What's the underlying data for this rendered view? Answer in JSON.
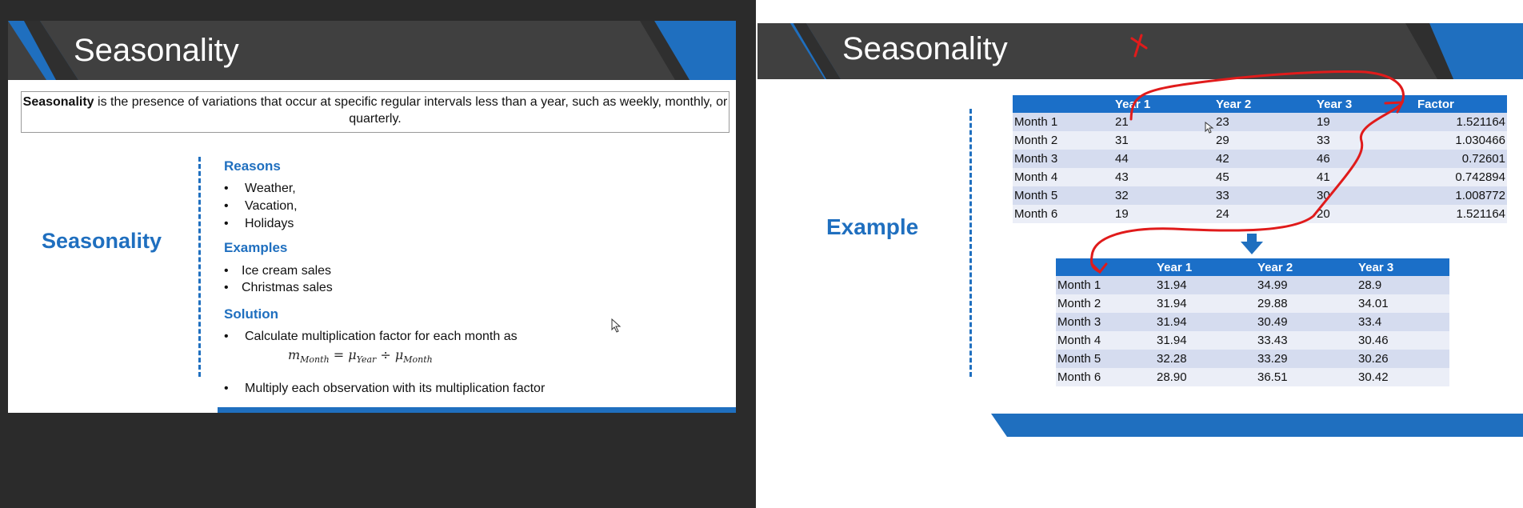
{
  "left_slide": {
    "title": "Seasonality",
    "definition_bold": "Seasonality",
    "definition_rest": " is the presence of variations that occur at specific regular intervals less than a year, such as weekly, monthly, or quarterly.",
    "side_label": "Seasonality",
    "sections": {
      "reasons": {
        "heading": "Reasons",
        "items": [
          "Weather,",
          "Vacation,",
          "Holidays"
        ]
      },
      "examples": {
        "heading": "Examples",
        "items": [
          "Ice cream sales",
          "Christmas sales"
        ]
      },
      "solution": {
        "heading": "Solution",
        "item1": "Calculate multiplication factor for each month as",
        "item2": "Multiply each observation with its multiplication factor"
      }
    },
    "formula": {
      "m": "m",
      "m_sub": "Month",
      "eq": " = ",
      "mu1": "μ",
      "mu1_sub": "Year",
      "div": " ÷ ",
      "mu2": "μ",
      "mu2_sub": "Month"
    },
    "bullet_char": "•"
  },
  "right_slide": {
    "title": "Seasonality",
    "side_label": "Example",
    "table1": {
      "headers": [
        "",
        "Year 1",
        "Year 2",
        "Year 3",
        "Factor"
      ],
      "rows": [
        [
          "Month 1",
          "21",
          "23",
          "19",
          "1.521164"
        ],
        [
          "Month 2",
          "31",
          "29",
          "33",
          "1.030466"
        ],
        [
          "Month 3",
          "44",
          "42",
          "46",
          "0.72601"
        ],
        [
          "Month 4",
          "43",
          "45",
          "41",
          "0.742894"
        ],
        [
          "Month 5",
          "32",
          "33",
          "30",
          "1.008772"
        ],
        [
          "Month 6",
          "19",
          "24",
          "20",
          "1.521164"
        ]
      ]
    },
    "table2": {
      "headers": [
        "",
        "Year 1",
        "Year 2",
        "Year 3"
      ],
      "rows": [
        [
          "Month 1",
          "31.94",
          "34.99",
          "28.9"
        ],
        [
          "Month 2",
          "31.94",
          "29.88",
          "34.01"
        ],
        [
          "Month 3",
          "31.94",
          "30.49",
          "33.4"
        ],
        [
          "Month 4",
          "31.94",
          "33.43",
          "30.46"
        ],
        [
          "Month 5",
          "32.28",
          "33.29",
          "30.26"
        ],
        [
          "Month 6",
          "28.90",
          "36.51",
          "30.42"
        ]
      ]
    }
  },
  "colors": {
    "accent_blue": "#1f6fbf",
    "title_bar": "#404040",
    "annotation_red": "#e01b1b",
    "table_header": "#1b6fc8"
  }
}
